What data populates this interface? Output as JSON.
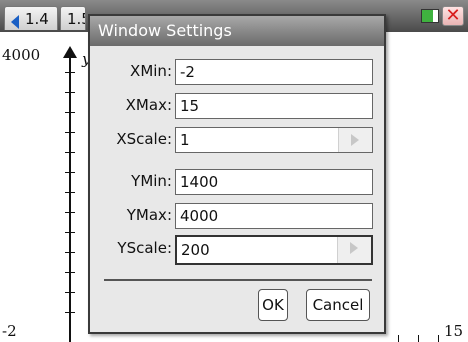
{
  "status_bar": {
    "tabs": [
      {
        "label": "1.4"
      },
      {
        "label": "1.5"
      }
    ]
  },
  "graph": {
    "y_axis_label": "y",
    "y_max_label": "4000",
    "x_min_label": "-2",
    "x_max_label": "15"
  },
  "dialog": {
    "title": "Window Settings",
    "fields": [
      {
        "label": "XMin:",
        "value": "-2"
      },
      {
        "label": "XMax:",
        "value": "15"
      },
      {
        "label": "XScale:",
        "value": "1"
      },
      {
        "label": "YMin:",
        "value": "1400"
      },
      {
        "label": "YMax:",
        "value": "4000"
      },
      {
        "label": "YScale:",
        "value": "200"
      }
    ],
    "ok_label": "OK",
    "cancel_label": "Cancel"
  }
}
